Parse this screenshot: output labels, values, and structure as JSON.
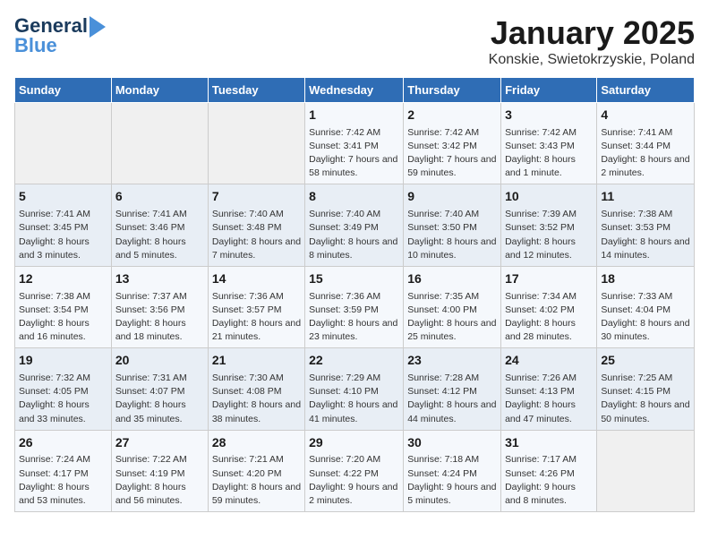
{
  "logo": {
    "line1": "General",
    "line2": "Blue"
  },
  "title": "January 2025",
  "subtitle": "Konskie, Swietokrzyskie, Poland",
  "days_of_week": [
    "Sunday",
    "Monday",
    "Tuesday",
    "Wednesday",
    "Thursday",
    "Friday",
    "Saturday"
  ],
  "weeks": [
    [
      {
        "day": "",
        "info": ""
      },
      {
        "day": "",
        "info": ""
      },
      {
        "day": "",
        "info": ""
      },
      {
        "day": "1",
        "info": "Sunrise: 7:42 AM\nSunset: 3:41 PM\nDaylight: 7 hours and 58 minutes."
      },
      {
        "day": "2",
        "info": "Sunrise: 7:42 AM\nSunset: 3:42 PM\nDaylight: 7 hours and 59 minutes."
      },
      {
        "day": "3",
        "info": "Sunrise: 7:42 AM\nSunset: 3:43 PM\nDaylight: 8 hours and 1 minute."
      },
      {
        "day": "4",
        "info": "Sunrise: 7:41 AM\nSunset: 3:44 PM\nDaylight: 8 hours and 2 minutes."
      }
    ],
    [
      {
        "day": "5",
        "info": "Sunrise: 7:41 AM\nSunset: 3:45 PM\nDaylight: 8 hours and 3 minutes."
      },
      {
        "day": "6",
        "info": "Sunrise: 7:41 AM\nSunset: 3:46 PM\nDaylight: 8 hours and 5 minutes."
      },
      {
        "day": "7",
        "info": "Sunrise: 7:40 AM\nSunset: 3:48 PM\nDaylight: 8 hours and 7 minutes."
      },
      {
        "day": "8",
        "info": "Sunrise: 7:40 AM\nSunset: 3:49 PM\nDaylight: 8 hours and 8 minutes."
      },
      {
        "day": "9",
        "info": "Sunrise: 7:40 AM\nSunset: 3:50 PM\nDaylight: 8 hours and 10 minutes."
      },
      {
        "day": "10",
        "info": "Sunrise: 7:39 AM\nSunset: 3:52 PM\nDaylight: 8 hours and 12 minutes."
      },
      {
        "day": "11",
        "info": "Sunrise: 7:38 AM\nSunset: 3:53 PM\nDaylight: 8 hours and 14 minutes."
      }
    ],
    [
      {
        "day": "12",
        "info": "Sunrise: 7:38 AM\nSunset: 3:54 PM\nDaylight: 8 hours and 16 minutes."
      },
      {
        "day": "13",
        "info": "Sunrise: 7:37 AM\nSunset: 3:56 PM\nDaylight: 8 hours and 18 minutes."
      },
      {
        "day": "14",
        "info": "Sunrise: 7:36 AM\nSunset: 3:57 PM\nDaylight: 8 hours and 21 minutes."
      },
      {
        "day": "15",
        "info": "Sunrise: 7:36 AM\nSunset: 3:59 PM\nDaylight: 8 hours and 23 minutes."
      },
      {
        "day": "16",
        "info": "Sunrise: 7:35 AM\nSunset: 4:00 PM\nDaylight: 8 hours and 25 minutes."
      },
      {
        "day": "17",
        "info": "Sunrise: 7:34 AM\nSunset: 4:02 PM\nDaylight: 8 hours and 28 minutes."
      },
      {
        "day": "18",
        "info": "Sunrise: 7:33 AM\nSunset: 4:04 PM\nDaylight: 8 hours and 30 minutes."
      }
    ],
    [
      {
        "day": "19",
        "info": "Sunrise: 7:32 AM\nSunset: 4:05 PM\nDaylight: 8 hours and 33 minutes."
      },
      {
        "day": "20",
        "info": "Sunrise: 7:31 AM\nSunset: 4:07 PM\nDaylight: 8 hours and 35 minutes."
      },
      {
        "day": "21",
        "info": "Sunrise: 7:30 AM\nSunset: 4:08 PM\nDaylight: 8 hours and 38 minutes."
      },
      {
        "day": "22",
        "info": "Sunrise: 7:29 AM\nSunset: 4:10 PM\nDaylight: 8 hours and 41 minutes."
      },
      {
        "day": "23",
        "info": "Sunrise: 7:28 AM\nSunset: 4:12 PM\nDaylight: 8 hours and 44 minutes."
      },
      {
        "day": "24",
        "info": "Sunrise: 7:26 AM\nSunset: 4:13 PM\nDaylight: 8 hours and 47 minutes."
      },
      {
        "day": "25",
        "info": "Sunrise: 7:25 AM\nSunset: 4:15 PM\nDaylight: 8 hours and 50 minutes."
      }
    ],
    [
      {
        "day": "26",
        "info": "Sunrise: 7:24 AM\nSunset: 4:17 PM\nDaylight: 8 hours and 53 minutes."
      },
      {
        "day": "27",
        "info": "Sunrise: 7:22 AM\nSunset: 4:19 PM\nDaylight: 8 hours and 56 minutes."
      },
      {
        "day": "28",
        "info": "Sunrise: 7:21 AM\nSunset: 4:20 PM\nDaylight: 8 hours and 59 minutes."
      },
      {
        "day": "29",
        "info": "Sunrise: 7:20 AM\nSunset: 4:22 PM\nDaylight: 9 hours and 2 minutes."
      },
      {
        "day": "30",
        "info": "Sunrise: 7:18 AM\nSunset: 4:24 PM\nDaylight: 9 hours and 5 minutes."
      },
      {
        "day": "31",
        "info": "Sunrise: 7:17 AM\nSunset: 4:26 PM\nDaylight: 9 hours and 8 minutes."
      },
      {
        "day": "",
        "info": ""
      }
    ]
  ]
}
